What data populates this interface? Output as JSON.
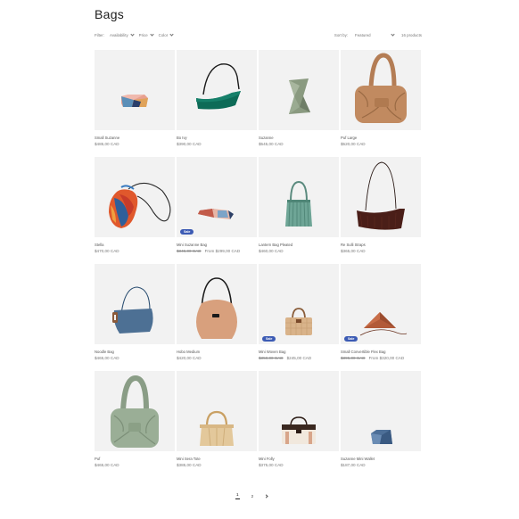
{
  "page": {
    "title": "Bags"
  },
  "filters": {
    "label": "Filter:",
    "items": [
      {
        "label": "Availability"
      },
      {
        "label": "Price"
      },
      {
        "label": "Color"
      }
    ],
    "sort_label": "Sort by:",
    "sort_value": "Featured",
    "product_count": "16 products"
  },
  "products": [
    {
      "name": "Small Suzanne",
      "price": "$485,00 CAD",
      "sale": false
    },
    {
      "name": "Bo Ivy",
      "price": "$390,00 CAD",
      "sale": false
    },
    {
      "name": "Suzanne",
      "price": "$545,00 CAD",
      "sale": false
    },
    {
      "name": "Puf Large",
      "price": "$520,00 CAD",
      "sale": false
    },
    {
      "name": "Stella",
      "price": "$470,00 CAD",
      "sale": false
    },
    {
      "name": "Mini Suzanne Bag",
      "price": "From $299,00 CAD",
      "old_price": "$345,00 CAD",
      "sale": true,
      "badge": "Sale"
    },
    {
      "name": "Lantern Bag Pleated",
      "price": "$460,00 CAD",
      "sale": false
    },
    {
      "name": "Re Sulli Straps",
      "price": "$365,00 CAD",
      "sale": false
    },
    {
      "name": "Noodle Bag",
      "price": "$465,00 CAD",
      "sale": false
    },
    {
      "name": "Hobo Medium",
      "price": "$420,00 CAD",
      "sale": false
    },
    {
      "name": "Mini Woven Bag",
      "price": "$245,00 CAD",
      "old_price": "$350,00 CAD",
      "sale": true,
      "badge": "Sale"
    },
    {
      "name": "Small Convertible Flex Bag",
      "price": "From $320,00 CAD",
      "old_price": "$395,00 CAD",
      "sale": true,
      "badge": "Sale"
    },
    {
      "name": "Puf",
      "price": "$465,00 CAD",
      "sale": false
    },
    {
      "name": "Mini Sera Tote",
      "price": "$385,00 CAD",
      "sale": false
    },
    {
      "name": "Mini Folly",
      "price": "$375,00 CAD",
      "sale": false
    },
    {
      "name": "Suzanne Mini Wallet",
      "price": "$187,00 CAD",
      "sale": false
    }
  ],
  "pagination": {
    "pages": [
      "1",
      "2"
    ],
    "current": "1"
  },
  "icons": {
    "filter_chevron": "chevron-down-icon",
    "next": "chevron-right-icon"
  },
  "colors": {
    "sale_badge": "#3c5bb4",
    "tile_bg": "#f2f2f2"
  }
}
